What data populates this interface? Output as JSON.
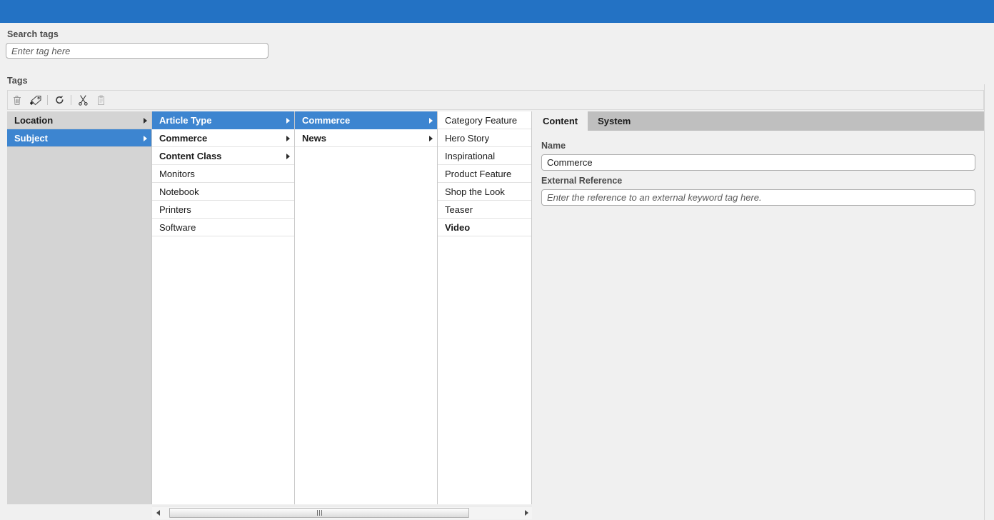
{
  "topbar": {
    "color": "#2372c4"
  },
  "search": {
    "label": "Search tags",
    "placeholder": "Enter tag here",
    "value": ""
  },
  "tags_section": {
    "label": "Tags",
    "toolbar": [
      {
        "name": "delete-tag-icon",
        "title": "Delete"
      },
      {
        "name": "add-tag-icon",
        "title": "New tag"
      },
      {
        "name": "refresh-icon",
        "title": "Refresh"
      },
      {
        "name": "cut-icon",
        "title": "Cut"
      },
      {
        "name": "paste-icon",
        "title": "Paste"
      }
    ]
  },
  "columns": [
    {
      "id": "col1",
      "items": [
        {
          "label": "Location",
          "bold": true,
          "has_children": true,
          "selected": false
        },
        {
          "label": "Subject",
          "bold": true,
          "has_children": true,
          "selected": true
        }
      ]
    },
    {
      "id": "col2",
      "items": [
        {
          "label": "Article Type",
          "bold": true,
          "has_children": true,
          "selected": true
        },
        {
          "label": "Commerce",
          "bold": true,
          "has_children": true,
          "selected": false
        },
        {
          "label": "Content Class",
          "bold": true,
          "has_children": true,
          "selected": false
        },
        {
          "label": "Monitors",
          "bold": false,
          "has_children": false,
          "selected": false
        },
        {
          "label": "Notebook",
          "bold": false,
          "has_children": false,
          "selected": false
        },
        {
          "label": "Printers",
          "bold": false,
          "has_children": false,
          "selected": false
        },
        {
          "label": "Software",
          "bold": false,
          "has_children": false,
          "selected": false
        }
      ]
    },
    {
      "id": "col3",
      "items": [
        {
          "label": "Commerce",
          "bold": true,
          "has_children": true,
          "selected": true
        },
        {
          "label": "News",
          "bold": true,
          "has_children": true,
          "selected": false
        }
      ]
    },
    {
      "id": "col4",
      "items": [
        {
          "label": "Category Feature",
          "bold": false,
          "has_children": false,
          "selected": false
        },
        {
          "label": "Hero Story",
          "bold": false,
          "has_children": false,
          "selected": false
        },
        {
          "label": "Inspirational",
          "bold": false,
          "has_children": false,
          "selected": false
        },
        {
          "label": "Product Feature",
          "bold": false,
          "has_children": false,
          "selected": false
        },
        {
          "label": "Shop the Look",
          "bold": false,
          "has_children": false,
          "selected": false
        },
        {
          "label": "Teaser",
          "bold": false,
          "has_children": false,
          "selected": false
        },
        {
          "label": "Video",
          "bold": true,
          "has_children": false,
          "selected": false
        }
      ]
    }
  ],
  "scrollbar": {
    "left_arrow": "scroll-left",
    "right_arrow": "scroll-right"
  },
  "panel": {
    "tabs": [
      {
        "label": "Content",
        "active": true
      },
      {
        "label": "System",
        "active": false
      }
    ],
    "name": {
      "label": "Name",
      "value": "Commerce",
      "placeholder": ""
    },
    "external_reference": {
      "label": "External Reference",
      "value": "",
      "placeholder": "Enter the reference to an external keyword tag here."
    }
  },
  "colors": {
    "accent": "#2372c4",
    "selection": "#3d85d0",
    "panel_bg": "#f0f0f0",
    "column1_bg": "#d4d4d4",
    "tabstrip_bg": "#bfbfbf"
  }
}
